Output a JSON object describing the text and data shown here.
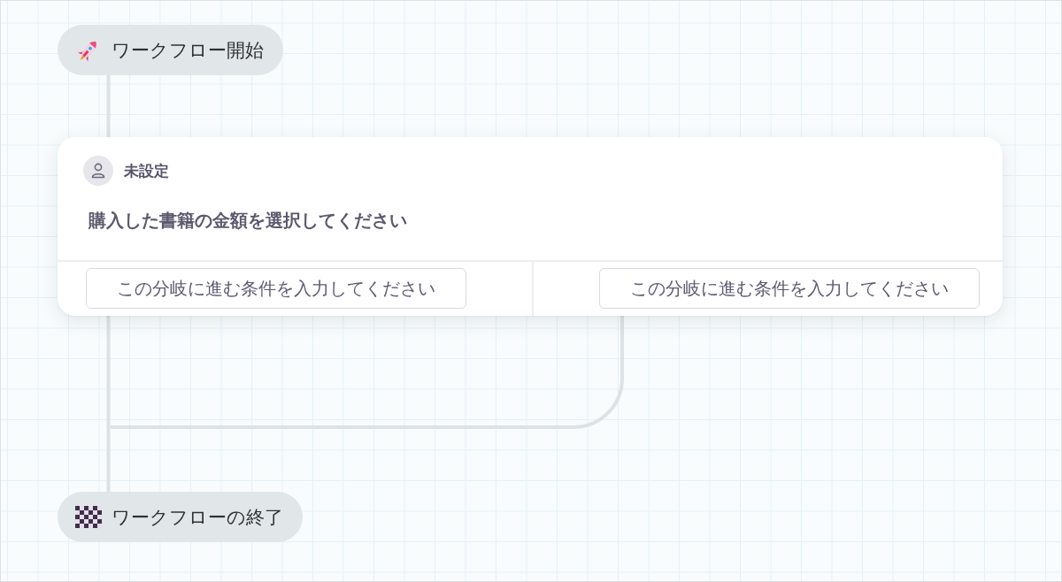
{
  "start_node": {
    "label": "ワークフロー開始"
  },
  "branch_card": {
    "assignee": "未設定",
    "question": "購入した書籍の金額を選択してください",
    "branches": [
      {
        "placeholder": "この分岐に進む条件を入力してください"
      },
      {
        "placeholder": "この分岐に進む条件を入力してください"
      }
    ]
  },
  "end_node": {
    "label": "ワークフローの終了"
  }
}
